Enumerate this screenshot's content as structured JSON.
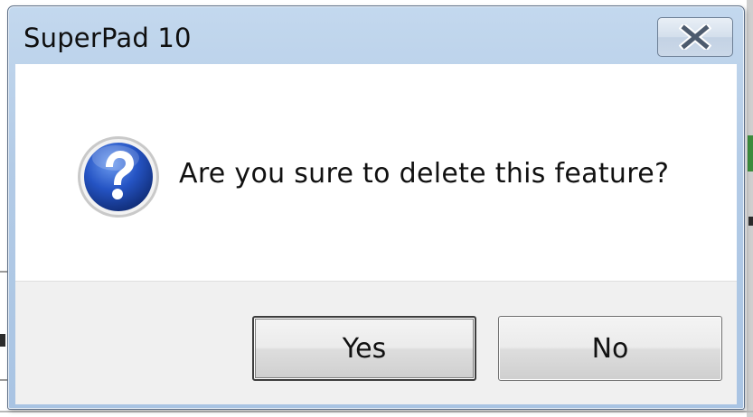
{
  "dialog": {
    "title": "SuperPad 10",
    "message": "Are you sure to delete this feature?",
    "icon": "question-icon",
    "close_icon": "close-icon"
  },
  "buttons": {
    "yes_label": "Yes",
    "no_label": "No"
  },
  "colors": {
    "titlebar": "#b3cbe6",
    "button_area": "#f0f0f0",
    "question_icon": "#1f4fb8"
  }
}
